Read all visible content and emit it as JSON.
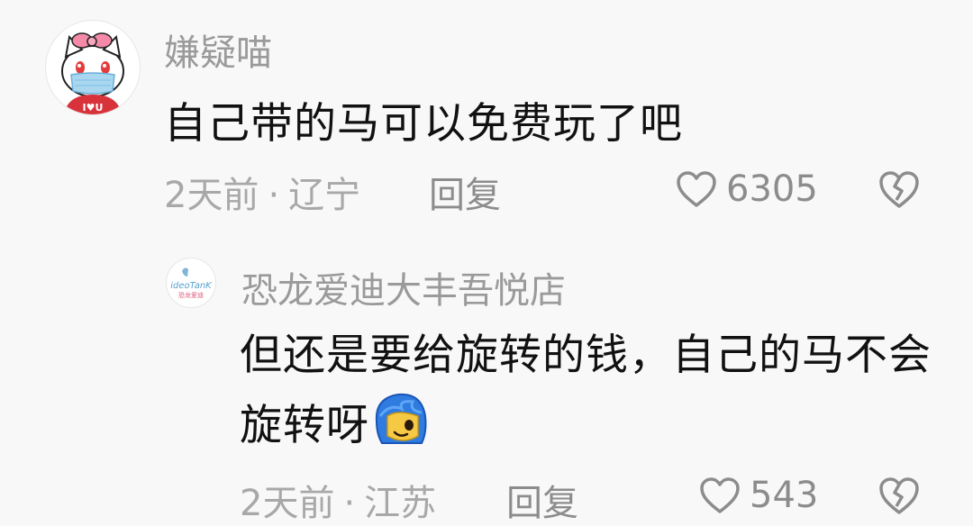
{
  "comments": [
    {
      "username": "嫌疑喵",
      "avatar": "hello-kitty-avatar",
      "avatar_badge": "I♥U",
      "text": "自己带的马可以免费玩了吧",
      "time": "2天前",
      "separator": "·",
      "location": "辽宁",
      "reply_label": "回复",
      "likes": "6305"
    },
    {
      "username": "恐龙爱迪大丰吾悦店",
      "avatar": "ideotank-logo-avatar",
      "avatar_logo_text": "ideoTanK",
      "avatar_logo_subtext": "恐龙爱迪",
      "text": "但还是要给旋转的钱，自己的马不会旋转呀",
      "emoji": "blue-hair-face-emoji",
      "time": "2天前",
      "separator": "·",
      "location": "江苏",
      "reply_label": "回复",
      "likes": "543"
    }
  ],
  "colors": {
    "background": "#f8f8f8",
    "username": "#9a9a9a",
    "body_text": "#111111",
    "meta_text": "#a8a8a8",
    "icon": "#8c8c8c"
  }
}
